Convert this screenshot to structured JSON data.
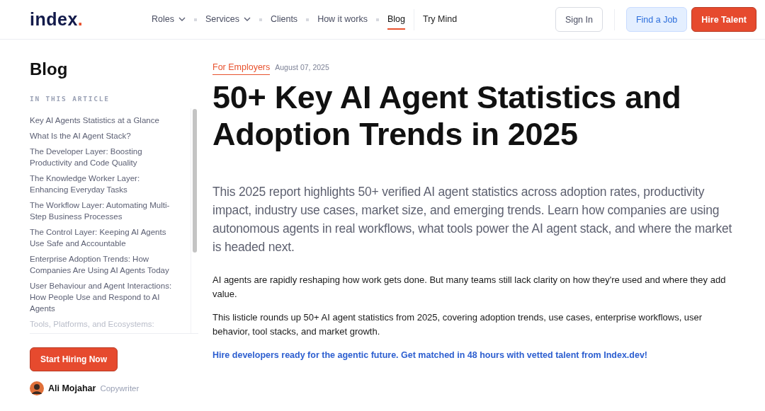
{
  "logo": {
    "name": "index",
    "dot": "."
  },
  "nav": [
    {
      "label": "Roles",
      "dropdown": true,
      "selected": false
    },
    {
      "label": "Services",
      "dropdown": true,
      "selected": false
    },
    {
      "label": "Clients",
      "dropdown": false,
      "selected": false
    },
    {
      "label": "How it works",
      "dropdown": false,
      "selected": false
    },
    {
      "label": "Blog",
      "dropdown": false,
      "selected": true
    },
    {
      "label": "Try Mind",
      "dropdown": false,
      "selected": false
    }
  ],
  "actions": [
    {
      "label": "Sign In",
      "kind": "outline"
    },
    {
      "label": "Find a Job",
      "kind": "soft"
    },
    {
      "label": "Hire Talent",
      "kind": "primary"
    }
  ],
  "sidebar": {
    "title": "Blog",
    "toc_heading": "IN THIS ARTICLE",
    "toc": [
      {
        "text": "Key AI Agents Statistics at a Glance",
        "faded": false
      },
      {
        "text": "What Is the AI Agent Stack?",
        "faded": false
      },
      {
        "text": "The Developer Layer: Boosting Productivity and Code Quality",
        "faded": false
      },
      {
        "text": "The Knowledge Worker Layer: Enhancing Everyday Tasks",
        "faded": false
      },
      {
        "text": "The Workflow Layer: Automating Multi-Step Business Processes",
        "faded": false
      },
      {
        "text": "The Control Layer: Keeping AI Agents Use Safe and Accountable",
        "faded": false
      },
      {
        "text": "Enterprise Adoption Trends: How Companies Are Using AI Agents Today",
        "faded": false
      },
      {
        "text": "User Behaviour and Agent Interactions: How People Use and Respond to AI Agents",
        "faded": false
      },
      {
        "text": "Tools, Platforms, and Ecosystems:",
        "faded": true
      }
    ],
    "cta": "Start Hiring Now",
    "author": {
      "name": "Ali Mojahar",
      "role": "Copywriter"
    }
  },
  "article": {
    "category": "For Employers",
    "date": "August 07, 2025",
    "title": "50+ Key AI Agent Statistics and Adoption Trends in 2025",
    "lead": "This 2025 report highlights 50+ verified AI agent statistics across adoption rates, productivity impact, industry use cases, market size, and emerging trends. Learn how companies are using autonomous agents in real workflows, what tools power the AI agent stack, and where the market is headed next.",
    "paragraphs": [
      "AI agents are rapidly reshaping how work gets done. But many teams still lack clarity on how they're used and where they add value.",
      "This listicle rounds up 50+ AI agent statistics from 2025, covering adoption trends, use cases, enterprise workflows, user behavior, tool stacks, and market growth."
    ],
    "link": "Hire developers ready for the agentic future. Get matched in 48 hours with vetted talent from Index.dev!"
  }
}
